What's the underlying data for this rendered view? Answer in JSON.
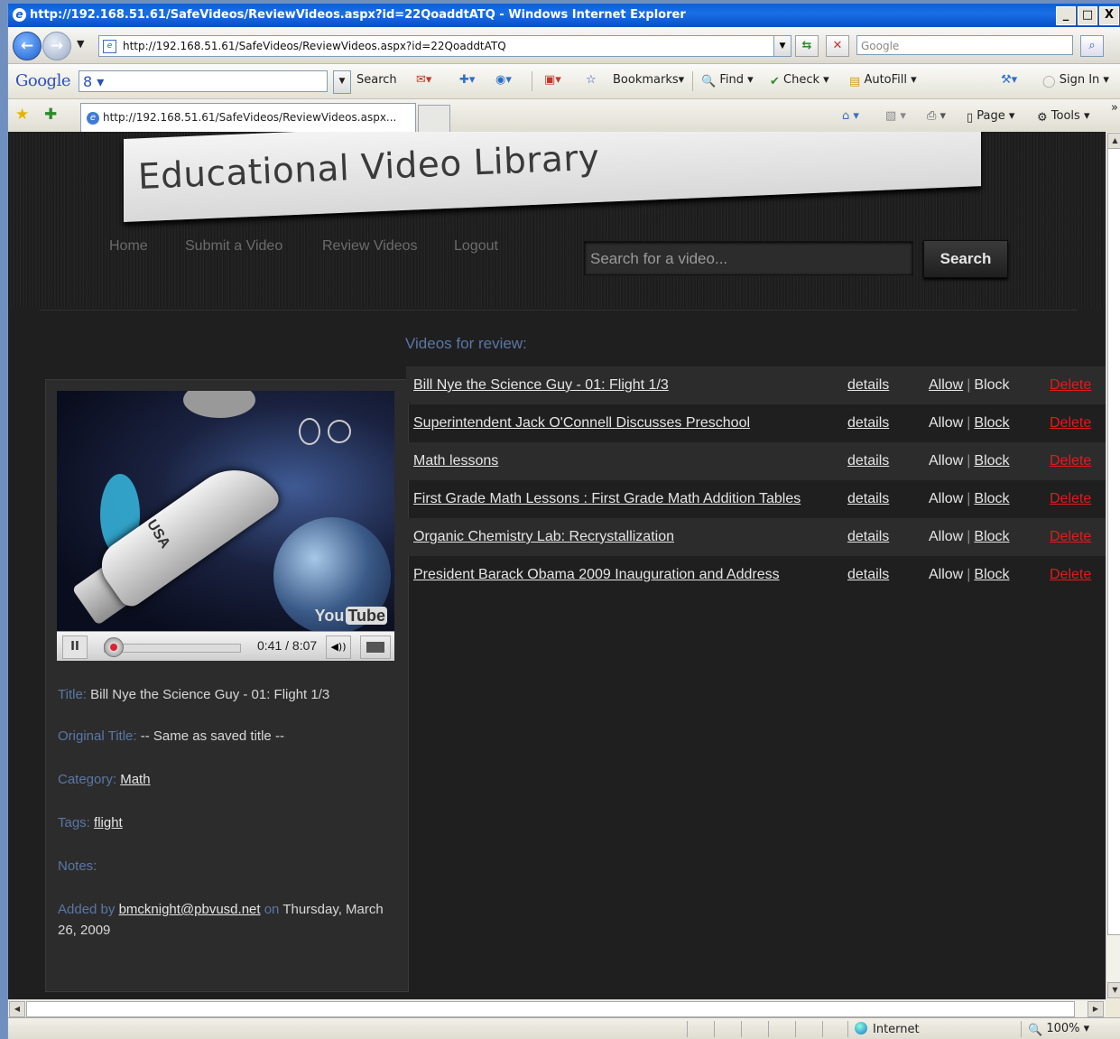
{
  "window": {
    "title": "http://192.168.51.61/SafeVideos/ReviewVideos.aspx?id=22QoaddtATQ - Windows Internet Explorer",
    "minimize": "_",
    "maximize": "□",
    "close": "X"
  },
  "nav": {
    "url": "http://192.168.51.61/SafeVideos/ReviewVideos.aspx?id=22QoaddtATQ",
    "search_placeholder": "Google"
  },
  "google_toolbar": {
    "logo": "Google",
    "box_value": "8",
    "items": [
      "Search",
      "Bookmarks",
      "Find",
      "Check",
      "AutoFill",
      "Sign In"
    ]
  },
  "favorites": {
    "tab_title": "http://192.168.51.61/SafeVideos/ReviewVideos.aspx...",
    "items": [
      "Page",
      "Tools"
    ]
  },
  "site": {
    "logo": "Educational Video Library",
    "menu": [
      "Home",
      "Submit a Video",
      "Review Videos",
      "Logout"
    ],
    "search_placeholder": "Search for a video...",
    "search_button": "Search"
  },
  "review": {
    "heading": "Videos for review:",
    "details_label": "details",
    "allow_label": "Allow",
    "separator": "|",
    "block_label": "Block",
    "delete_label": "Delete",
    "videos": [
      {
        "title": "Bill Nye the Science Guy - 01: Flight 1/3"
      },
      {
        "title": "Superintendent Jack O'Connell Discusses Preschool"
      },
      {
        "title": "Math lessons"
      },
      {
        "title": "First Grade Math Lessons : First Grade Math Addition Tables"
      },
      {
        "title": "Organic Chemistry Lab: Recrystallization"
      },
      {
        "title": "President Barack Obama 2009 Inauguration and Address"
      }
    ]
  },
  "player": {
    "overlay_text": "USA",
    "brand_left": "You",
    "brand_right": "Tube",
    "pause": "II",
    "time": "0:41 / 8:07",
    "progress": 0.085
  },
  "details": {
    "title_label": "Title:",
    "title_value": "Bill Nye the Science Guy - 01: Flight 1/3",
    "original_label": "Original Title:",
    "original_value": "-- Same as saved title --",
    "category_label": "Category:",
    "category_value": "Math",
    "tags_label": "Tags:",
    "tags_value": "flight",
    "notes_label": "Notes:",
    "added_label": "Added by",
    "added_user": "bmcknight@pbvusd.net",
    "added_on": "on",
    "added_date": "Thursday, March 26, 2009"
  },
  "status": {
    "zone": "Internet",
    "zoom": "100%"
  }
}
